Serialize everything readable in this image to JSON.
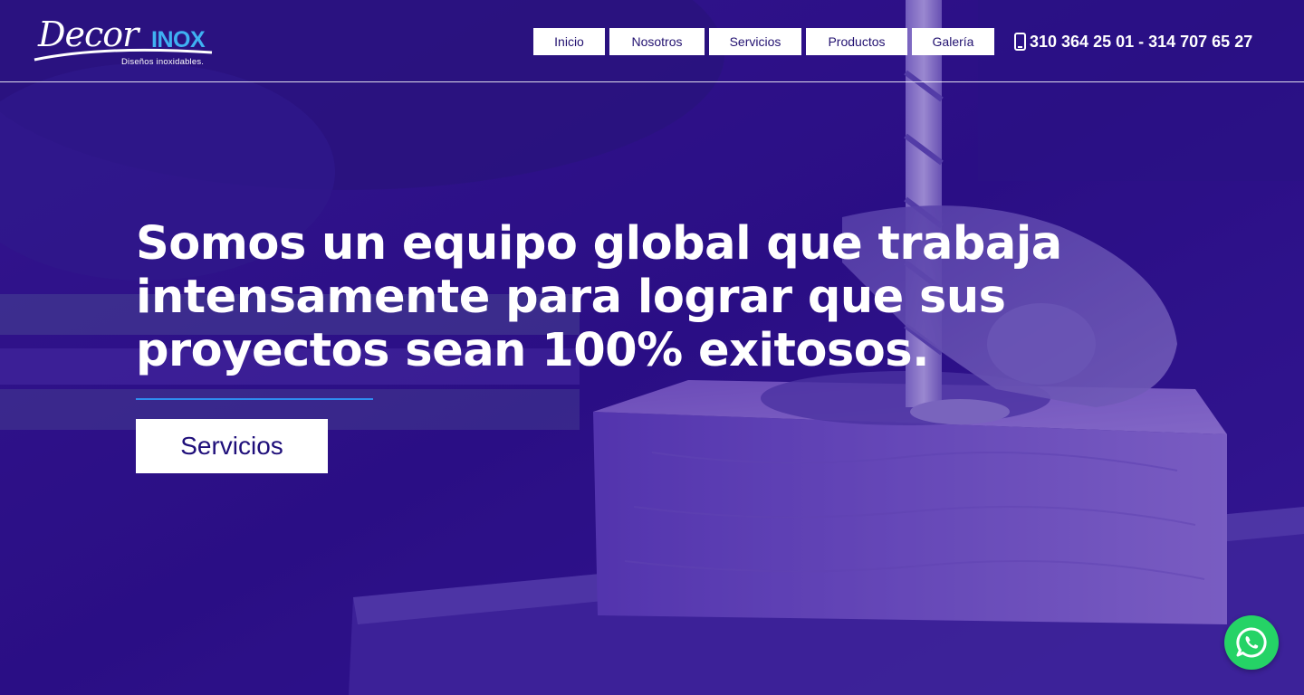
{
  "brand": {
    "logo_script": "Decor",
    "logo_bold": "INOX",
    "tagline": "Diseños inoxidables.",
    "colors": {
      "overlay": "#2a1380",
      "accent_blue": "#3fb1f2",
      "divider": "#2f8df0",
      "button_text": "#1f0f7a",
      "whatsapp": "#25d366"
    }
  },
  "nav": {
    "items": [
      {
        "label": "Inicio"
      },
      {
        "label": "Nosotros"
      },
      {
        "label": "Servicios"
      },
      {
        "label": "Productos"
      },
      {
        "label": "Galería"
      }
    ]
  },
  "contact": {
    "phone": "310 364 25 01 - 314 707 65 27",
    "icon": "mobile-phone-icon"
  },
  "hero": {
    "line1": "Somos un equipo global que trabaja",
    "line2": "intensamente para lograr que sus",
    "line3": "proyectos sean 100% exitosos.",
    "cta_label": "Servicios",
    "background": "workshop drill pressing wooden block (purple tint)"
  },
  "floating": {
    "whatsapp_icon": "whatsapp-icon"
  }
}
